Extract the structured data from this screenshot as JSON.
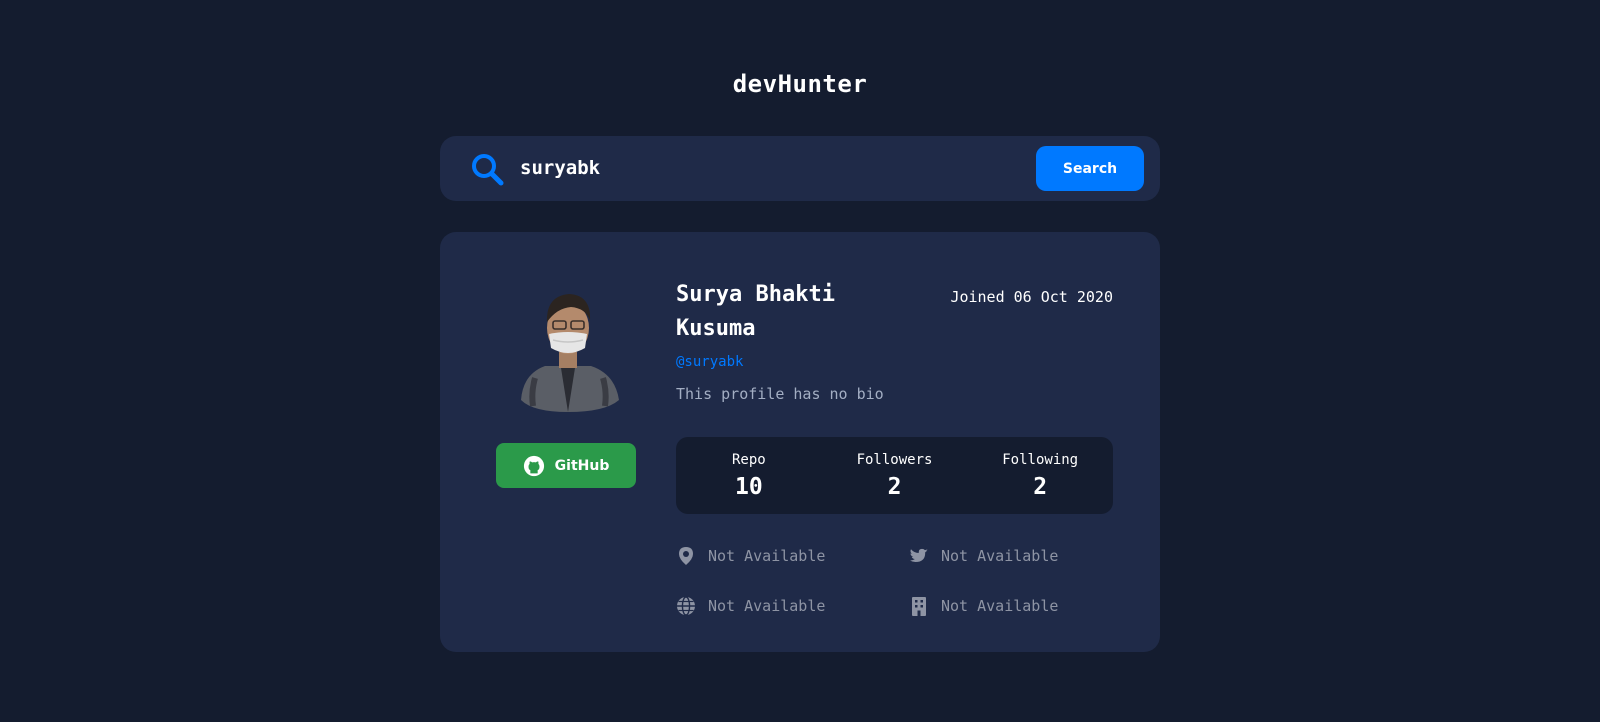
{
  "header": {
    "title": "devHunter"
  },
  "search": {
    "value": "suryabk",
    "button_label": "Search"
  },
  "profile": {
    "name": "Surya Bhakti Kusuma",
    "joined": "Joined 06 Oct 2020",
    "username": "@suryabk",
    "bio": "This profile has no bio",
    "github_button_label": "GitHub"
  },
  "stats": {
    "repo_label": "Repo",
    "repo_value": "10",
    "followers_label": "Followers",
    "followers_value": "2",
    "following_label": "Following",
    "following_value": "2"
  },
  "links": {
    "location": "Not Available",
    "twitter": "Not Available",
    "website": "Not Available",
    "company": "Not Available"
  },
  "icons": {
    "search": "search-icon",
    "github": "github-icon",
    "location": "location-pin-icon",
    "twitter": "twitter-icon",
    "website": "globe-icon",
    "company": "building-icon"
  },
  "colors": {
    "background": "#141c2f",
    "card": "#1f2a48",
    "accent": "#0079ff",
    "github_green": "#2b9a4a",
    "muted_text": "#8e94a4"
  }
}
